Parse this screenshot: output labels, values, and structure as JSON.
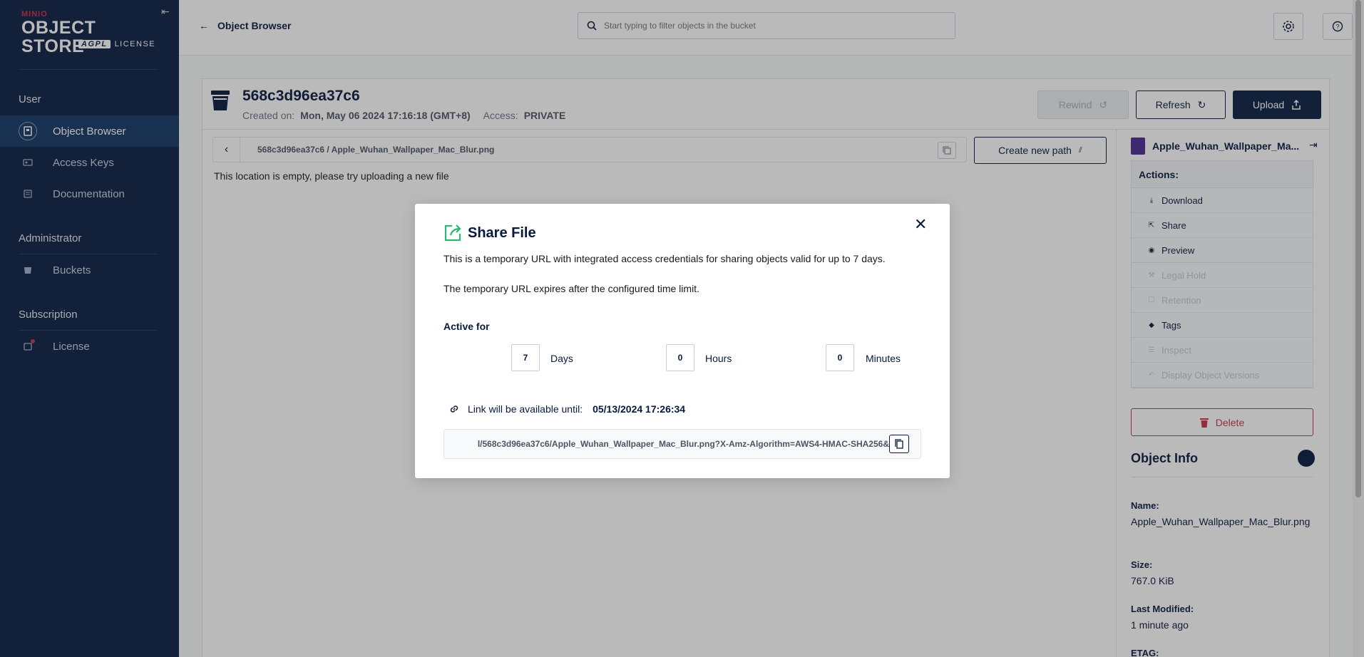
{
  "sidebar": {
    "logo_top": "MINIO",
    "logo_main": "OBJECT STORE",
    "logo_agpl": "AGPL",
    "logo_license": "LICENSE",
    "sections": {
      "user": "User",
      "administrator": "Administrator",
      "subscription": "Subscription"
    },
    "items": {
      "object_browser": "Object Browser",
      "access_keys": "Access Keys",
      "documentation": "Documentation",
      "buckets": "Buckets",
      "license": "License"
    }
  },
  "topbar": {
    "back_label": "Object Browser",
    "search_placeholder": "Start typing to filter objects in the bucket"
  },
  "bucket": {
    "name": "568c3d96ea37c6",
    "created_label": "Created on:",
    "created_value": "Mon, May 06 2024 17:16:18 (GMT+8)",
    "access_label": "Access:",
    "access_value": "PRIVATE",
    "rewind_label": "Rewind",
    "refresh_label": "Refresh",
    "upload_label": "Upload",
    "path": "568c3d96ea37c6 / Apple_Wuhan_Wallpaper_Mac_Blur.png",
    "create_path_label": "Create new path",
    "empty_message": "This location is empty, please try uploading a new file"
  },
  "object_panel": {
    "file_name": "Apple_Wuhan_Wallpaper_Ma...",
    "actions_title": "Actions:",
    "actions": {
      "download": "Download",
      "share": "Share",
      "preview": "Preview",
      "legal_hold": "Legal Hold",
      "retention": "Retention",
      "tags": "Tags",
      "inspect": "Inspect",
      "versions": "Display Object Versions"
    },
    "delete_label": "Delete",
    "info_title": "Object Info",
    "name_label": "Name:",
    "name_value": "Apple_Wuhan_Wallpaper_Mac_Blur.png",
    "size_label": "Size:",
    "size_value": "767.0 KiB",
    "modified_label": "Last Modified:",
    "modified_value": "1 minute ago",
    "etag_label": "ETAG:"
  },
  "modal": {
    "title": "Share File",
    "description": "This is a temporary URL with integrated access credentials for sharing objects valid for up to 7 days.",
    "expiry_note": "The temporary URL expires after the configured time limit.",
    "active_for_label": "Active for",
    "days_value": "7",
    "days_label": "Days",
    "hours_value": "0",
    "hours_label": "Hours",
    "minutes_value": "0",
    "minutes_label": "Minutes",
    "available_label": "Link will be available until:",
    "available_value": "05/13/2024 17:26:34",
    "url": "l/568c3d96ea37c6/Apple_Wuhan_Wallpaper_Mac_Blur.png?X-Amz-Algorithm=AWS4-HMAC-SHA256&"
  },
  "colors": {
    "sidebar_bg": "#081c42",
    "accent_green": "#2bb673",
    "danger": "#c72e49"
  }
}
